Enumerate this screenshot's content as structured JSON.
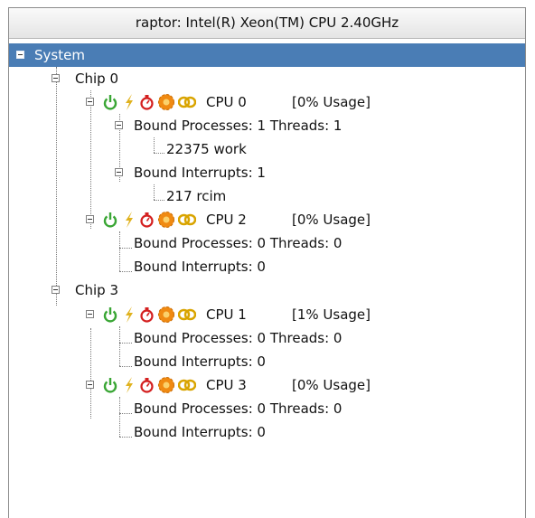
{
  "window_title": "raptor:  Intel(R) Xeon(TM) CPU 2.40GHz",
  "tree": {
    "root": "System",
    "chips": [
      {
        "label": "Chip 0",
        "cpus": [
          {
            "label": "CPU 0",
            "usage": "[0% Usage]",
            "processes": "Bound Processes: 1 Threads: 1",
            "process_items": [
              "22375 work"
            ],
            "interrupts": "Bound Interrupts: 1",
            "interrupt_items": [
              "217 rcim"
            ]
          },
          {
            "label": "CPU 2",
            "usage": "[0% Usage]",
            "processes": "Bound Processes: 0 Threads: 0",
            "interrupts": "Bound Interrupts: 0"
          }
        ]
      },
      {
        "label": "Chip 3",
        "cpus": [
          {
            "label": "CPU 1",
            "usage": "[1% Usage]",
            "processes": "Bound Processes: 0 Threads: 0",
            "interrupts": "Bound Interrupts: 0"
          },
          {
            "label": "CPU 3",
            "usage": "[0% Usage]",
            "processes": "Bound Processes: 0 Threads: 0",
            "interrupts": "Bound Interrupts: 0"
          }
        ]
      }
    ]
  },
  "colors": {
    "selection": "#4a7db5",
    "power_icon": "#3aa635",
    "interrupt_icon": "#e0b21e",
    "timer_icon": "#d42020",
    "gear_icon": "#f08a12",
    "link_icon": "#d9a400"
  },
  "icons": [
    "power-icon",
    "lightning-icon",
    "stopwatch-icon",
    "gear-icon",
    "link-icon"
  ]
}
